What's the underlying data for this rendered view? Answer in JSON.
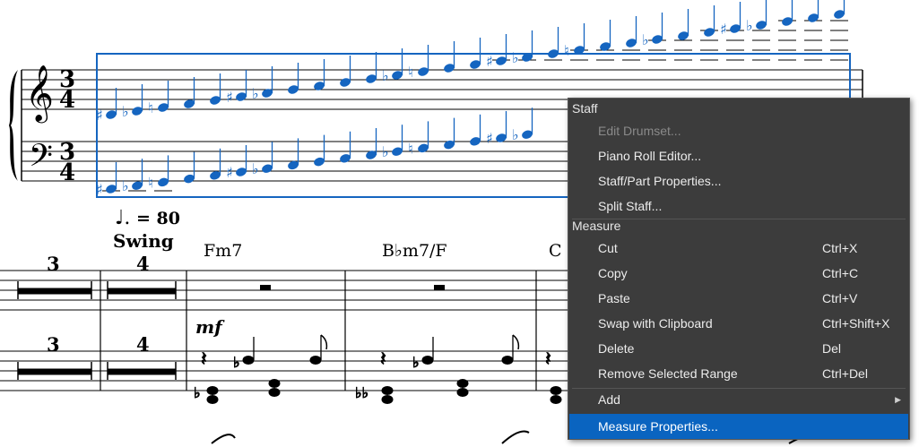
{
  "score": {
    "upper_clef": "𝄞",
    "lower_clef": "𝄢",
    "time_signature": {
      "upper": "3",
      "lower": "4"
    },
    "tempo_note": "♩.",
    "tempo_value": "= 80",
    "style_text": "Swing",
    "bar_numbers": [
      "3",
      "4",
      "3",
      "4"
    ],
    "chord_symbols": [
      "Fm7",
      "B♭m7/F",
      "C"
    ],
    "dynamic": "mf",
    "accent_color": "#1565c0"
  },
  "context_menu": {
    "sections": {
      "staff": "Staff",
      "measure": "Measure"
    },
    "items": {
      "edit_drumset": {
        "label": "Edit Drumset..."
      },
      "piano_roll": {
        "label": "Piano Roll Editor..."
      },
      "staff_part_props": {
        "label": "Staff/Part Properties..."
      },
      "split_staff": {
        "label": "Split Staff..."
      },
      "cut": {
        "label": "Cut",
        "shortcut": "Ctrl+X"
      },
      "copy": {
        "label": "Copy",
        "shortcut": "Ctrl+C"
      },
      "paste": {
        "label": "Paste",
        "shortcut": "Ctrl+V"
      },
      "swap": {
        "label": "Swap with Clipboard",
        "shortcut": "Ctrl+Shift+X"
      },
      "delete": {
        "label": "Delete",
        "shortcut": "Del"
      },
      "remove_range": {
        "label": "Remove Selected Range",
        "shortcut": "Ctrl+Del"
      },
      "add": {
        "label": "Add"
      },
      "measure_props": {
        "label": "Measure Properties..."
      }
    },
    "selected_item": "Measure Properties...",
    "background": "#3c3c3c",
    "highlight": "#0a64c0"
  }
}
